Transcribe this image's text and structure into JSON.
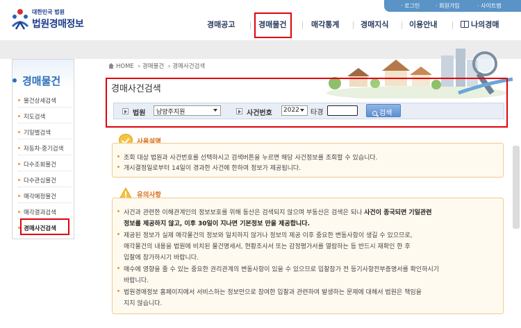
{
  "header": {
    "logo_small": "대한민국 법원",
    "logo_main": "법원경매정보",
    "util": [
      "로그인",
      "회원가입",
      "사이트맵"
    ],
    "gnb": [
      "경매공고",
      "경매물건",
      "매각통계",
      "경매지식",
      "이용안내",
      "나의경매"
    ]
  },
  "sidebar": {
    "title": "경매물건",
    "items": [
      {
        "label": "물건상세검색"
      },
      {
        "label": "지도검색"
      },
      {
        "label": "기일별검색"
      },
      {
        "label": "자동차·중기검색"
      },
      {
        "label": "다수조회물건"
      },
      {
        "label": "다수관심물건"
      },
      {
        "label": "매각예정물건"
      },
      {
        "label": "매각결과검색"
      },
      {
        "label": "경매사건검색"
      }
    ]
  },
  "breadcrumb": {
    "home": "HOME",
    "level1": "경매물건",
    "level2": "경매사건검색"
  },
  "page_title": "경매사건검색",
  "search": {
    "court_label": "법원",
    "court_value": "남양주지원",
    "case_label": "사건번호",
    "year_value": "2022",
    "tagyeong": "타경",
    "case_value": "",
    "button": "검색"
  },
  "usage": {
    "title": "사용설명",
    "lines": [
      "조회 대상 법원과 사건번호를 선택하시고 검색버튼을 누르면 해당 사건정보를 조회할 수 있습니다.",
      "개시결정일로부터 14일이 경과한 사건에 한하여 정보가 제공됩니다."
    ]
  },
  "caution": {
    "title": "유의사항",
    "b1_a": "사건과 관련한 이해관계인의 정보보호를 위해 동산은 검색되지 않으며 부동산은 검색은 되나",
    "b1_b": "사건이 종국되면 기일관련",
    "b1_c": "정보를 제공하지 않고, 이후 30일이 지나면 기본정보 만을 제공합니다.",
    "b2_a": "제공된 정보가 실제 매각물건의 정보와 일치하지 않거나 정보의 제공 이후 중요한 변동사항이 생길 수 있으므로,",
    "b2_b": "매각물건의 내용을 법원에 비치된 물건명세서, 현황조사서 또는 감정평가서를 열람하는 등 반드시 재확인 한 후",
    "b2_c": "입찰에 참가하시기 바랍니다.",
    "b3_a": "매수에 영향을 줄 수 있는 중요한 권리관계의 변동사항이 있을 수 있으므로 입찰참가 전 등기사항전부증명서를 확인하시기",
    "b3_b": "바랍니다.",
    "b4_a": "법원경매정보 홈페이지에서 서비스하는 정보만으로 참여한 입찰과 관련하여 발생하는 문제에 대해서 법원은 책임을",
    "b4_b": "지지 않습니다."
  }
}
